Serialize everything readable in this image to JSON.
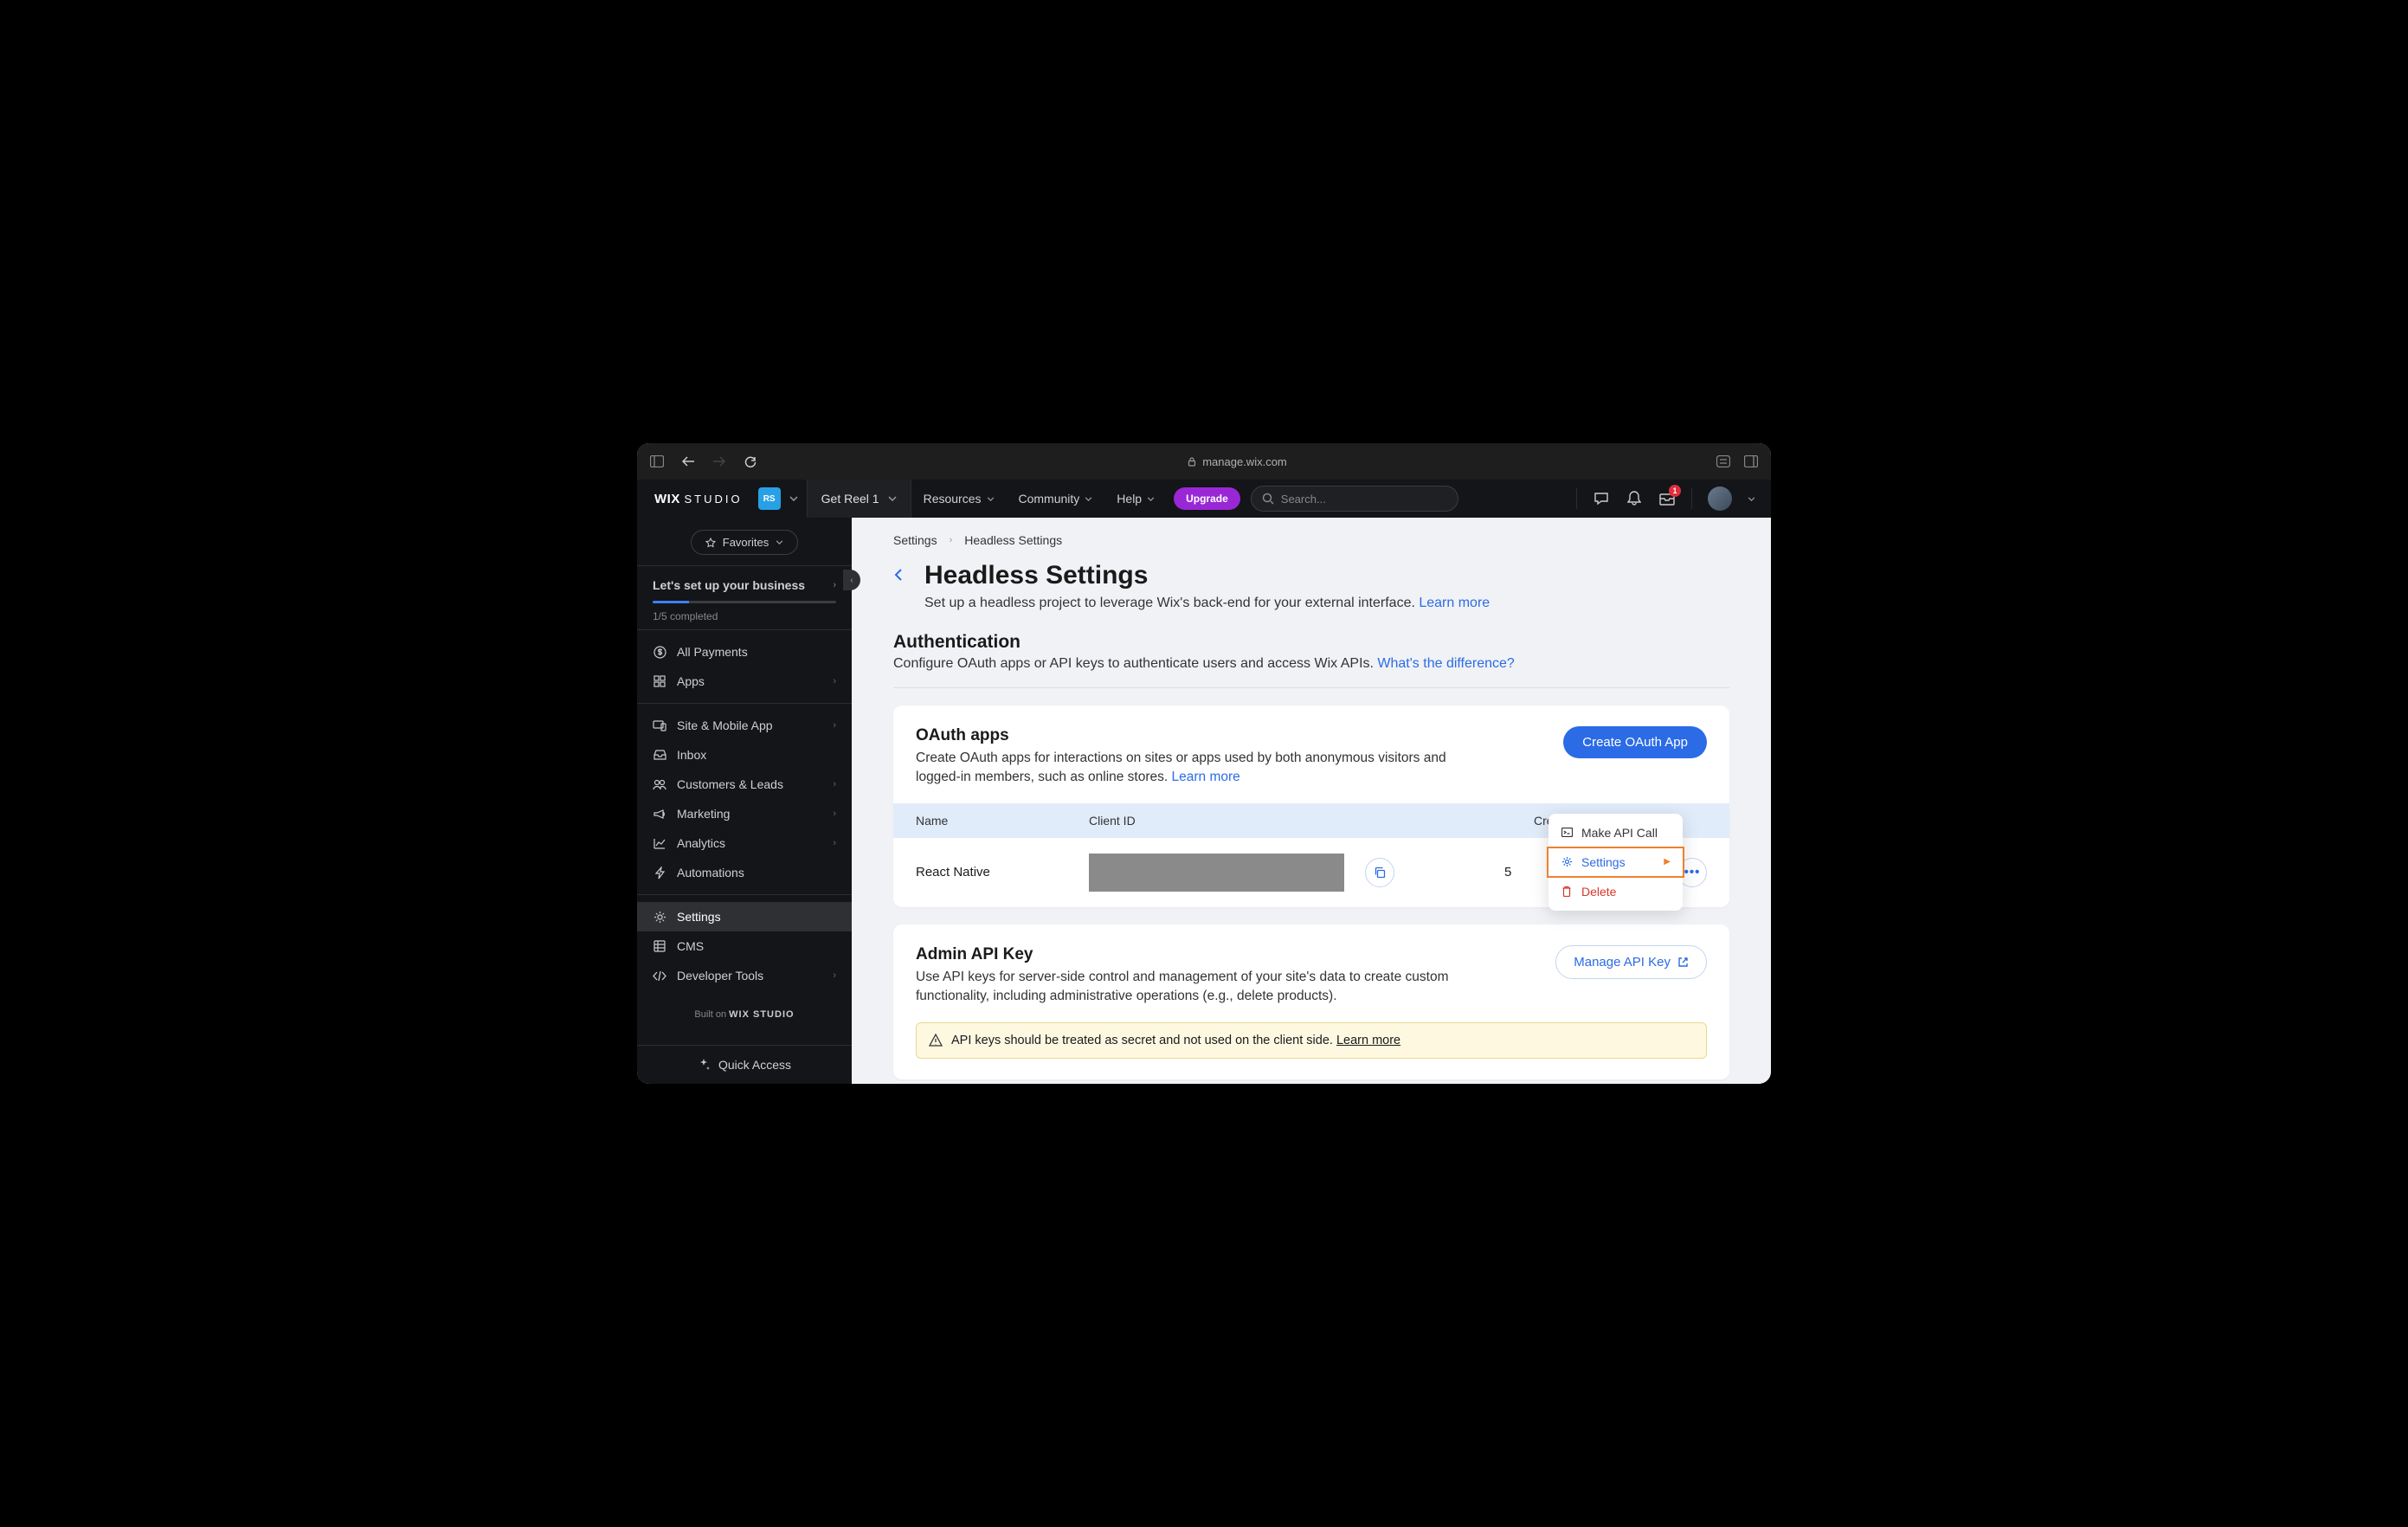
{
  "browser": {
    "url": "manage.wix.com"
  },
  "topbar": {
    "logo": "WIX",
    "logo2": "STUDIO",
    "workspace_badge": "RS",
    "project": "Get Reel 1",
    "links": [
      "Resources",
      "Community",
      "Help"
    ],
    "upgrade": "Upgrade",
    "search_placeholder": "Search...",
    "notif_count": "1"
  },
  "sidebar": {
    "favorites": "Favorites",
    "setup_title": "Let's set up your business",
    "setup_status": "1/5 completed",
    "items_a": [
      {
        "icon": "dollar",
        "label": "All Payments",
        "chev": false
      },
      {
        "icon": "grid",
        "label": "Apps",
        "chev": true
      }
    ],
    "items_b": [
      {
        "icon": "device",
        "label": "Site & Mobile App",
        "chev": true
      },
      {
        "icon": "inbox",
        "label": "Inbox",
        "chev": false
      },
      {
        "icon": "people",
        "label": "Customers & Leads",
        "chev": true
      },
      {
        "icon": "megaphone",
        "label": "Marketing",
        "chev": true
      },
      {
        "icon": "chart",
        "label": "Analytics",
        "chev": true
      },
      {
        "icon": "bolt",
        "label": "Automations",
        "chev": false
      }
    ],
    "items_c": [
      {
        "icon": "gear",
        "label": "Settings",
        "chev": false,
        "active": true
      },
      {
        "icon": "db",
        "label": "CMS",
        "chev": false
      },
      {
        "icon": "code",
        "label": "Developer Tools",
        "chev": true
      }
    ],
    "built_on_prefix": "Built on ",
    "built_on_brand": "WIX STUDIO",
    "quick_access": "Quick Access"
  },
  "breadcrumb": [
    "Settings",
    "Headless Settings"
  ],
  "page": {
    "title": "Headless Settings",
    "subtitle": "Set up a headless project to leverage Wix's back-end for your external interface. ",
    "learn_more": "Learn more"
  },
  "auth": {
    "heading": "Authentication",
    "desc": "Configure OAuth apps or API keys to authenticate users and access Wix APIs. ",
    "diff_link": "What's the difference?"
  },
  "oauth": {
    "heading": "OAuth apps",
    "desc": "Create OAuth apps for interactions on sites or apps used by both anonymous visitors and logged-in members, such as online stores. ",
    "learn_more": "Learn more",
    "button": "Create OAuth App",
    "cols": {
      "name": "Name",
      "client": "Client ID",
      "created": "Created"
    },
    "row": {
      "name": "React Native",
      "created": "5"
    },
    "menu": {
      "api": "Make API Call",
      "settings": "Settings",
      "delete": "Delete"
    }
  },
  "admin": {
    "heading": "Admin API Key",
    "desc": "Use API keys for server-side control and management of your site's data to create custom functionality, including administrative operations (e.g., delete products).",
    "button": "Manage API Key",
    "warning": "API keys should be treated as secret and not used on the client side. ",
    "warning_link": "Learn more"
  }
}
